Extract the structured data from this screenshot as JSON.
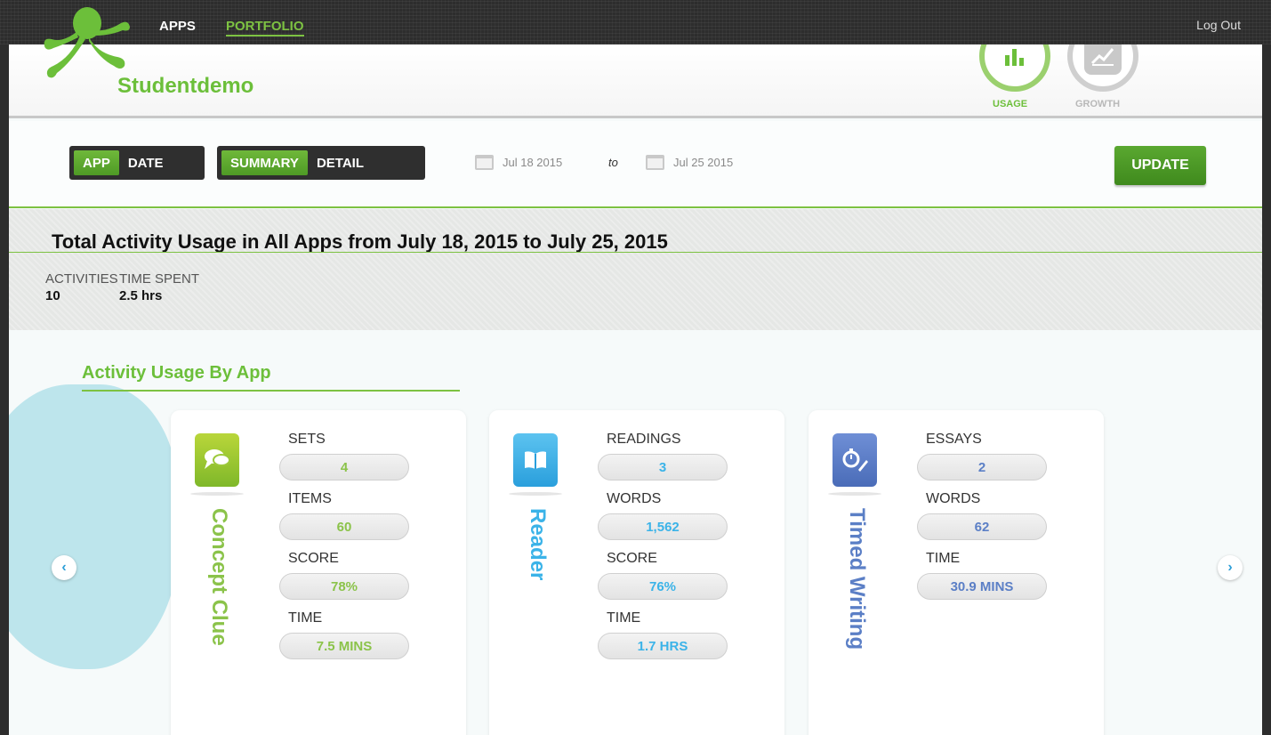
{
  "nav": {
    "apps": "APPS",
    "portfolio": "PORTFOLIO",
    "logout": "Log Out"
  },
  "header": {
    "username": "Studentdemo"
  },
  "view_tabs": [
    {
      "label": "USAGE",
      "icon": "bar-chart-icon",
      "active": true
    },
    {
      "label": "GROWTH",
      "icon": "line-chart-icon",
      "active": false
    }
  ],
  "toolbar": {
    "group_by": {
      "options": [
        "APP",
        "DATE"
      ],
      "selected": "APP"
    },
    "view_mode": {
      "options": [
        "SUMMARY",
        "DETAIL"
      ],
      "selected": "SUMMARY"
    },
    "from_date": "Jul 18 2015",
    "to_label": "to",
    "to_date": "Jul 25 2015",
    "update": "UPDATE"
  },
  "summary": {
    "title": "Total Activity Usage in All Apps from July 18, 2015 to July 25, 2015",
    "stats": [
      {
        "label": "ACTIVITIES",
        "value": "10"
      },
      {
        "label": "TIME SPENT",
        "value": "2.5 hrs"
      }
    ]
  },
  "section": {
    "title": "Activity Usage By App"
  },
  "apps": [
    {
      "name": "Concept Clue",
      "icon": "speech-bubbles-icon",
      "color": "#8bc34a",
      "metrics": [
        {
          "label": "SETS",
          "value": "4"
        },
        {
          "label": "ITEMS",
          "value": "60"
        },
        {
          "label": "SCORE",
          "value": "78%"
        },
        {
          "label": "TIME",
          "value": "7.5 MINS"
        }
      ]
    },
    {
      "name": "Reader",
      "icon": "book-icon",
      "color": "#3bb3e8",
      "metrics": [
        {
          "label": "READINGS",
          "value": "3"
        },
        {
          "label": "WORDS",
          "value": "1,562"
        },
        {
          "label": "SCORE",
          "value": "76%"
        },
        {
          "label": "TIME",
          "value": "1.7 HRS"
        }
      ]
    },
    {
      "name": "Timed Writing",
      "icon": "stopwatch-pencil-icon",
      "color": "#5b7fc6",
      "metrics": [
        {
          "label": "ESSAYS",
          "value": "2"
        },
        {
          "label": "WORDS",
          "value": "62"
        },
        {
          "label": "TIME",
          "value": "30.9 MINS"
        }
      ]
    }
  ]
}
